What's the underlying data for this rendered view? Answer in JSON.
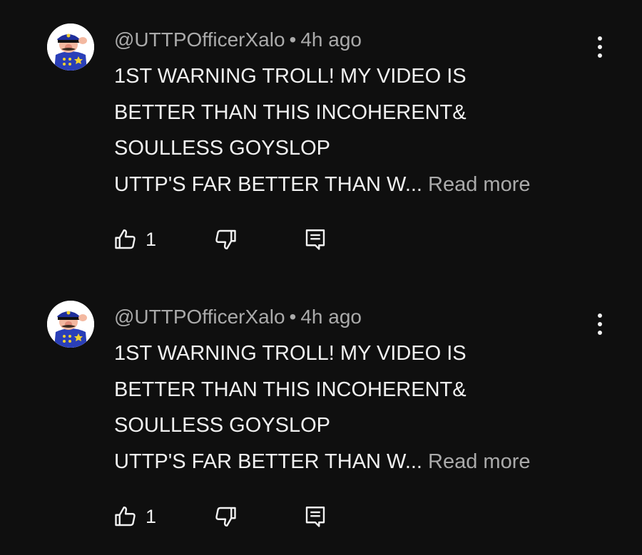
{
  "comments": [
    {
      "author": "@UTTPOfficerXalo",
      "separator": "•",
      "time": "4h ago",
      "lines": [
        "1ST WARNING TROLL! MY VIDEO IS",
        "BETTER THAN THIS INCOHERENT&",
        "SOULLESS GOYSLOP",
        "UTTP'S FAR BETTER THAN W..."
      ],
      "read_more": "Read more",
      "like_count": "1"
    },
    {
      "author": "@UTTPOfficerXalo",
      "separator": "•",
      "time": "4h ago",
      "lines": [
        "1ST WARNING TROLL! MY VIDEO IS",
        "BETTER THAN THIS INCOHERENT&",
        "SOULLESS GOYSLOP",
        "UTTP'S FAR BETTER THAN W..."
      ],
      "read_more": "Read more",
      "like_count": "1"
    }
  ],
  "icons": {
    "like": "thumbs-up-icon",
    "dislike": "thumbs-down-icon",
    "reply": "reply-comment-icon",
    "menu": "more-vertical-icon"
  },
  "colors": {
    "background": "#0f0f0f",
    "text": "#f1f1f1",
    "secondary": "#aaaaaa"
  }
}
